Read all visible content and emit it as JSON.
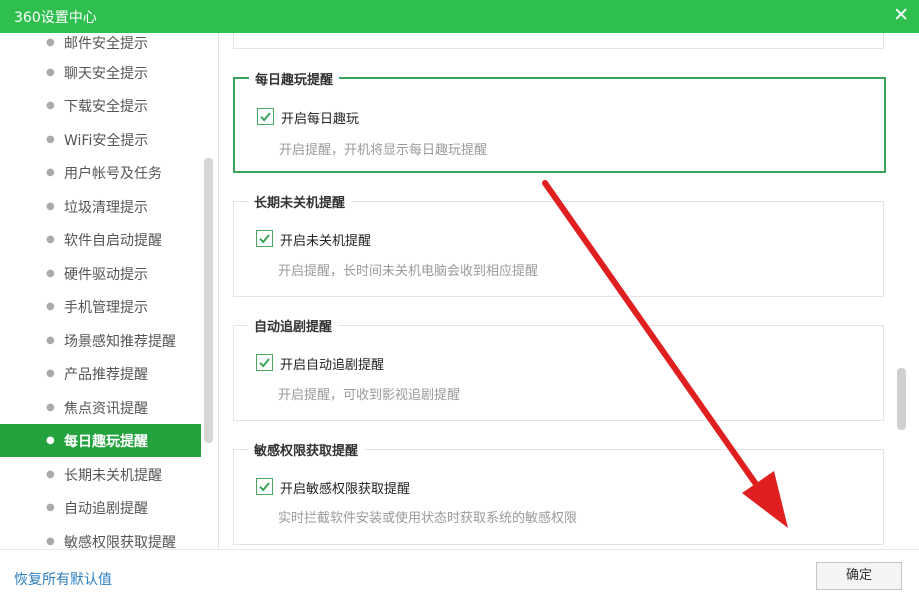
{
  "window": {
    "title": "360设置中心",
    "close_symbol": "✕"
  },
  "sidebar": {
    "items": [
      {
        "label": "邮件安全提示"
      },
      {
        "label": "聊天安全提示"
      },
      {
        "label": "下载安全提示"
      },
      {
        "label": "WiFi安全提示"
      },
      {
        "label": "用户帐号及任务"
      },
      {
        "label": "垃圾清理提示"
      },
      {
        "label": "软件自启动提醒"
      },
      {
        "label": "硬件驱动提示"
      },
      {
        "label": "手机管理提示"
      },
      {
        "label": "场景感知推荐提醒"
      },
      {
        "label": "产品推荐提醒"
      },
      {
        "label": "焦点资讯提醒"
      },
      {
        "label": "每日趣玩提醒",
        "active": true
      },
      {
        "label": "长期未关机提醒"
      },
      {
        "label": "自动追剧提醒"
      },
      {
        "label": "敏感权限获取提醒"
      }
    ]
  },
  "groups": [
    {
      "title": "每日趣玩提醒",
      "checkbox_label": "开启每日趣玩",
      "checked": true,
      "description": "开启提醒，开机将显示每日趣玩提醒"
    },
    {
      "title": "长期未关机提醒",
      "checkbox_label": "开启未关机提醒",
      "checked": true,
      "description": "开启提醒，长时间未关机电脑会收到相应提醒"
    },
    {
      "title": "自动追剧提醒",
      "checkbox_label": "开启自动追剧提醒",
      "checked": true,
      "description": "开启提醒，可收到影视追剧提醒"
    },
    {
      "title": "敏感权限获取提醒",
      "checkbox_label": "开启敏感权限获取提醒",
      "checked": true,
      "description": "实时拦截软件安装或使用状态时获取系统的敏感权限"
    }
  ],
  "footer": {
    "restore_label": "恢复所有默认值",
    "ok_label": "确定"
  },
  "colors": {
    "brand": "#2fbf4f",
    "active_item": "#23a23e",
    "arrow": "#e02020"
  }
}
